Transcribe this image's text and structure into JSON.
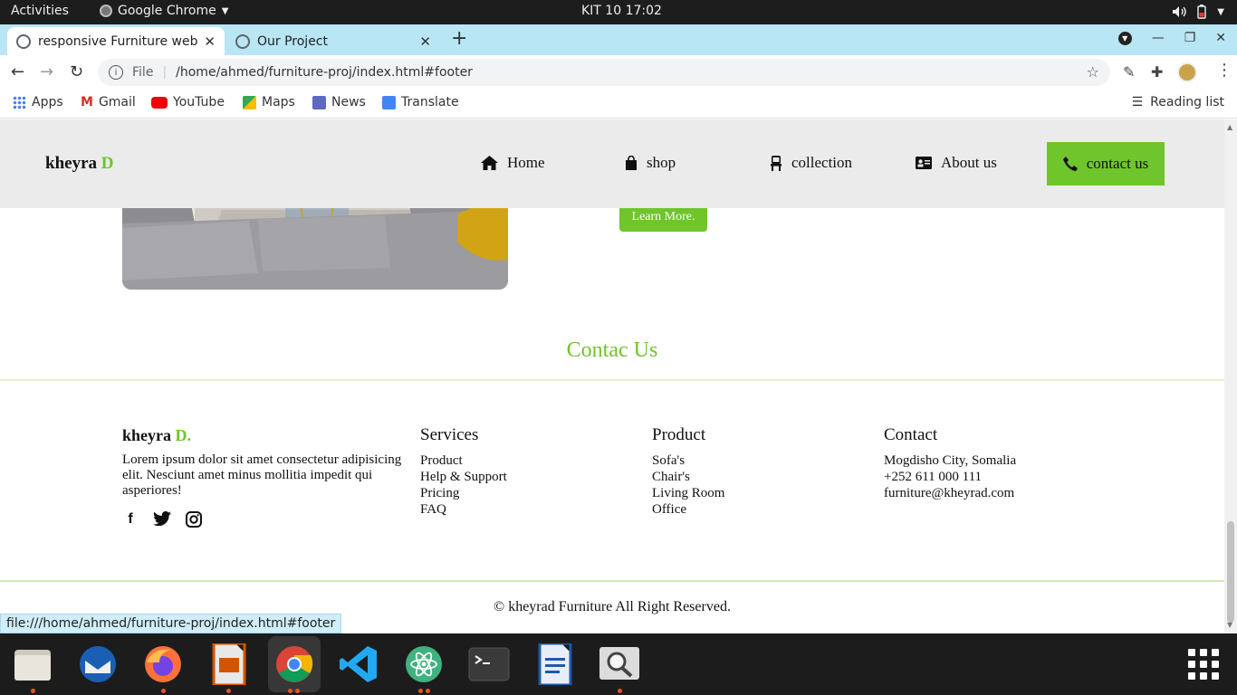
{
  "system": {
    "activities": "Activities",
    "app_name": "Google Chrome",
    "clock": "KIT 10  17:02"
  },
  "browser": {
    "tabs": [
      {
        "title": "responsive Furniture web",
        "icon": "globe-icon",
        "active": true
      },
      {
        "title": "Our Project",
        "icon": "globe-icon",
        "active": false
      }
    ],
    "url_scheme": "File",
    "url": "/home/ahmed/furniture-proj/index.html#footer",
    "bookmarks": [
      {
        "label": "Apps",
        "icon": "apps-grid-icon"
      },
      {
        "label": "Gmail",
        "icon": "gmail-icon"
      },
      {
        "label": "YouTube",
        "icon": "youtube-icon"
      },
      {
        "label": "Maps",
        "icon": "maps-icon"
      },
      {
        "label": "News",
        "icon": "news-icon"
      },
      {
        "label": "Translate",
        "icon": "translate-icon"
      }
    ],
    "reading_list": "Reading list",
    "status_url": "file:///home/ahmed/furniture-proj/index.html#footer"
  },
  "site": {
    "logo_text": "kheyra",
    "logo_accent": "D",
    "nav": [
      {
        "label": "Home",
        "icon": "home-icon"
      },
      {
        "label": "shop",
        "icon": "shopping-bag-icon"
      },
      {
        "label": "collection",
        "icon": "chair-icon"
      },
      {
        "label": "About us",
        "icon": "id-card-icon"
      }
    ],
    "cta": {
      "label": "contact us",
      "icon": "phone-icon"
    },
    "learn_more": "Learn More.",
    "contact_title": "Contac Us",
    "footer": {
      "brand": "kheyra",
      "brand_accent": "D.",
      "about": "Lorem ipsum dolor sit amet consectetur adipisicing elit. Nesciunt amet minus mollitia impedit qui asperiores!",
      "socials": [
        "facebook-icon",
        "twitter-icon",
        "instagram-icon"
      ],
      "services": {
        "title": "Services",
        "items": [
          "Product",
          "Help & Support",
          "Pricing",
          "FAQ"
        ]
      },
      "product": {
        "title": "Product",
        "items": [
          "Sofa's",
          "Chair's",
          "Living Room",
          "Office"
        ]
      },
      "contact": {
        "title": "Contact",
        "items": [
          "Mogdisho City, Somalia",
          "+252 611 000 111",
          "furniture@kheyrad.com"
        ]
      }
    },
    "copyright": "© kheyrad Furniture All Right Reserved.",
    "accent_color": "#6fc52b"
  },
  "dock": [
    {
      "name": "files",
      "running": true
    },
    {
      "name": "thunderbird",
      "running": false
    },
    {
      "name": "firefox",
      "running": true
    },
    {
      "name": "impress",
      "running": true
    },
    {
      "name": "chrome",
      "running": true
    },
    {
      "name": "vscode",
      "running": false
    },
    {
      "name": "atom",
      "running": true
    },
    {
      "name": "terminal",
      "running": false
    },
    {
      "name": "writer",
      "running": false
    },
    {
      "name": "image-viewer",
      "running": true
    }
  ]
}
